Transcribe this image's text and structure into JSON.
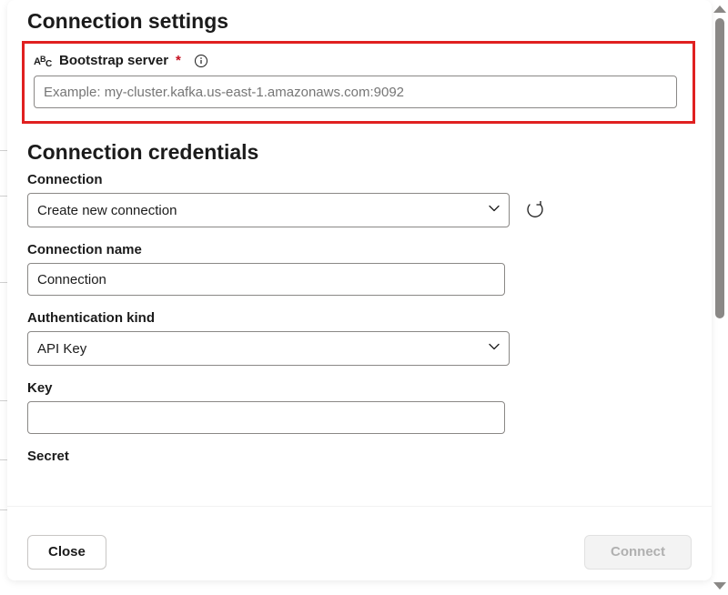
{
  "sections": {
    "settings": {
      "heading": "Connection settings",
      "bootstrap": {
        "label": "Bootstrap server",
        "required_mark": "*",
        "placeholder": "Example: my-cluster.kafka.us-east-1.amazonaws.com:9092",
        "value": ""
      }
    },
    "credentials": {
      "heading": "Connection credentials",
      "connection": {
        "label": "Connection",
        "selected": "Create new connection"
      },
      "connection_name": {
        "label": "Connection name",
        "value": "Connection"
      },
      "auth_kind": {
        "label": "Authentication kind",
        "selected": "API Key"
      },
      "key": {
        "label": "Key",
        "value": ""
      },
      "secret": {
        "label": "Secret",
        "value": ""
      }
    }
  },
  "footer": {
    "close_label": "Close",
    "connect_label": "Connect"
  }
}
